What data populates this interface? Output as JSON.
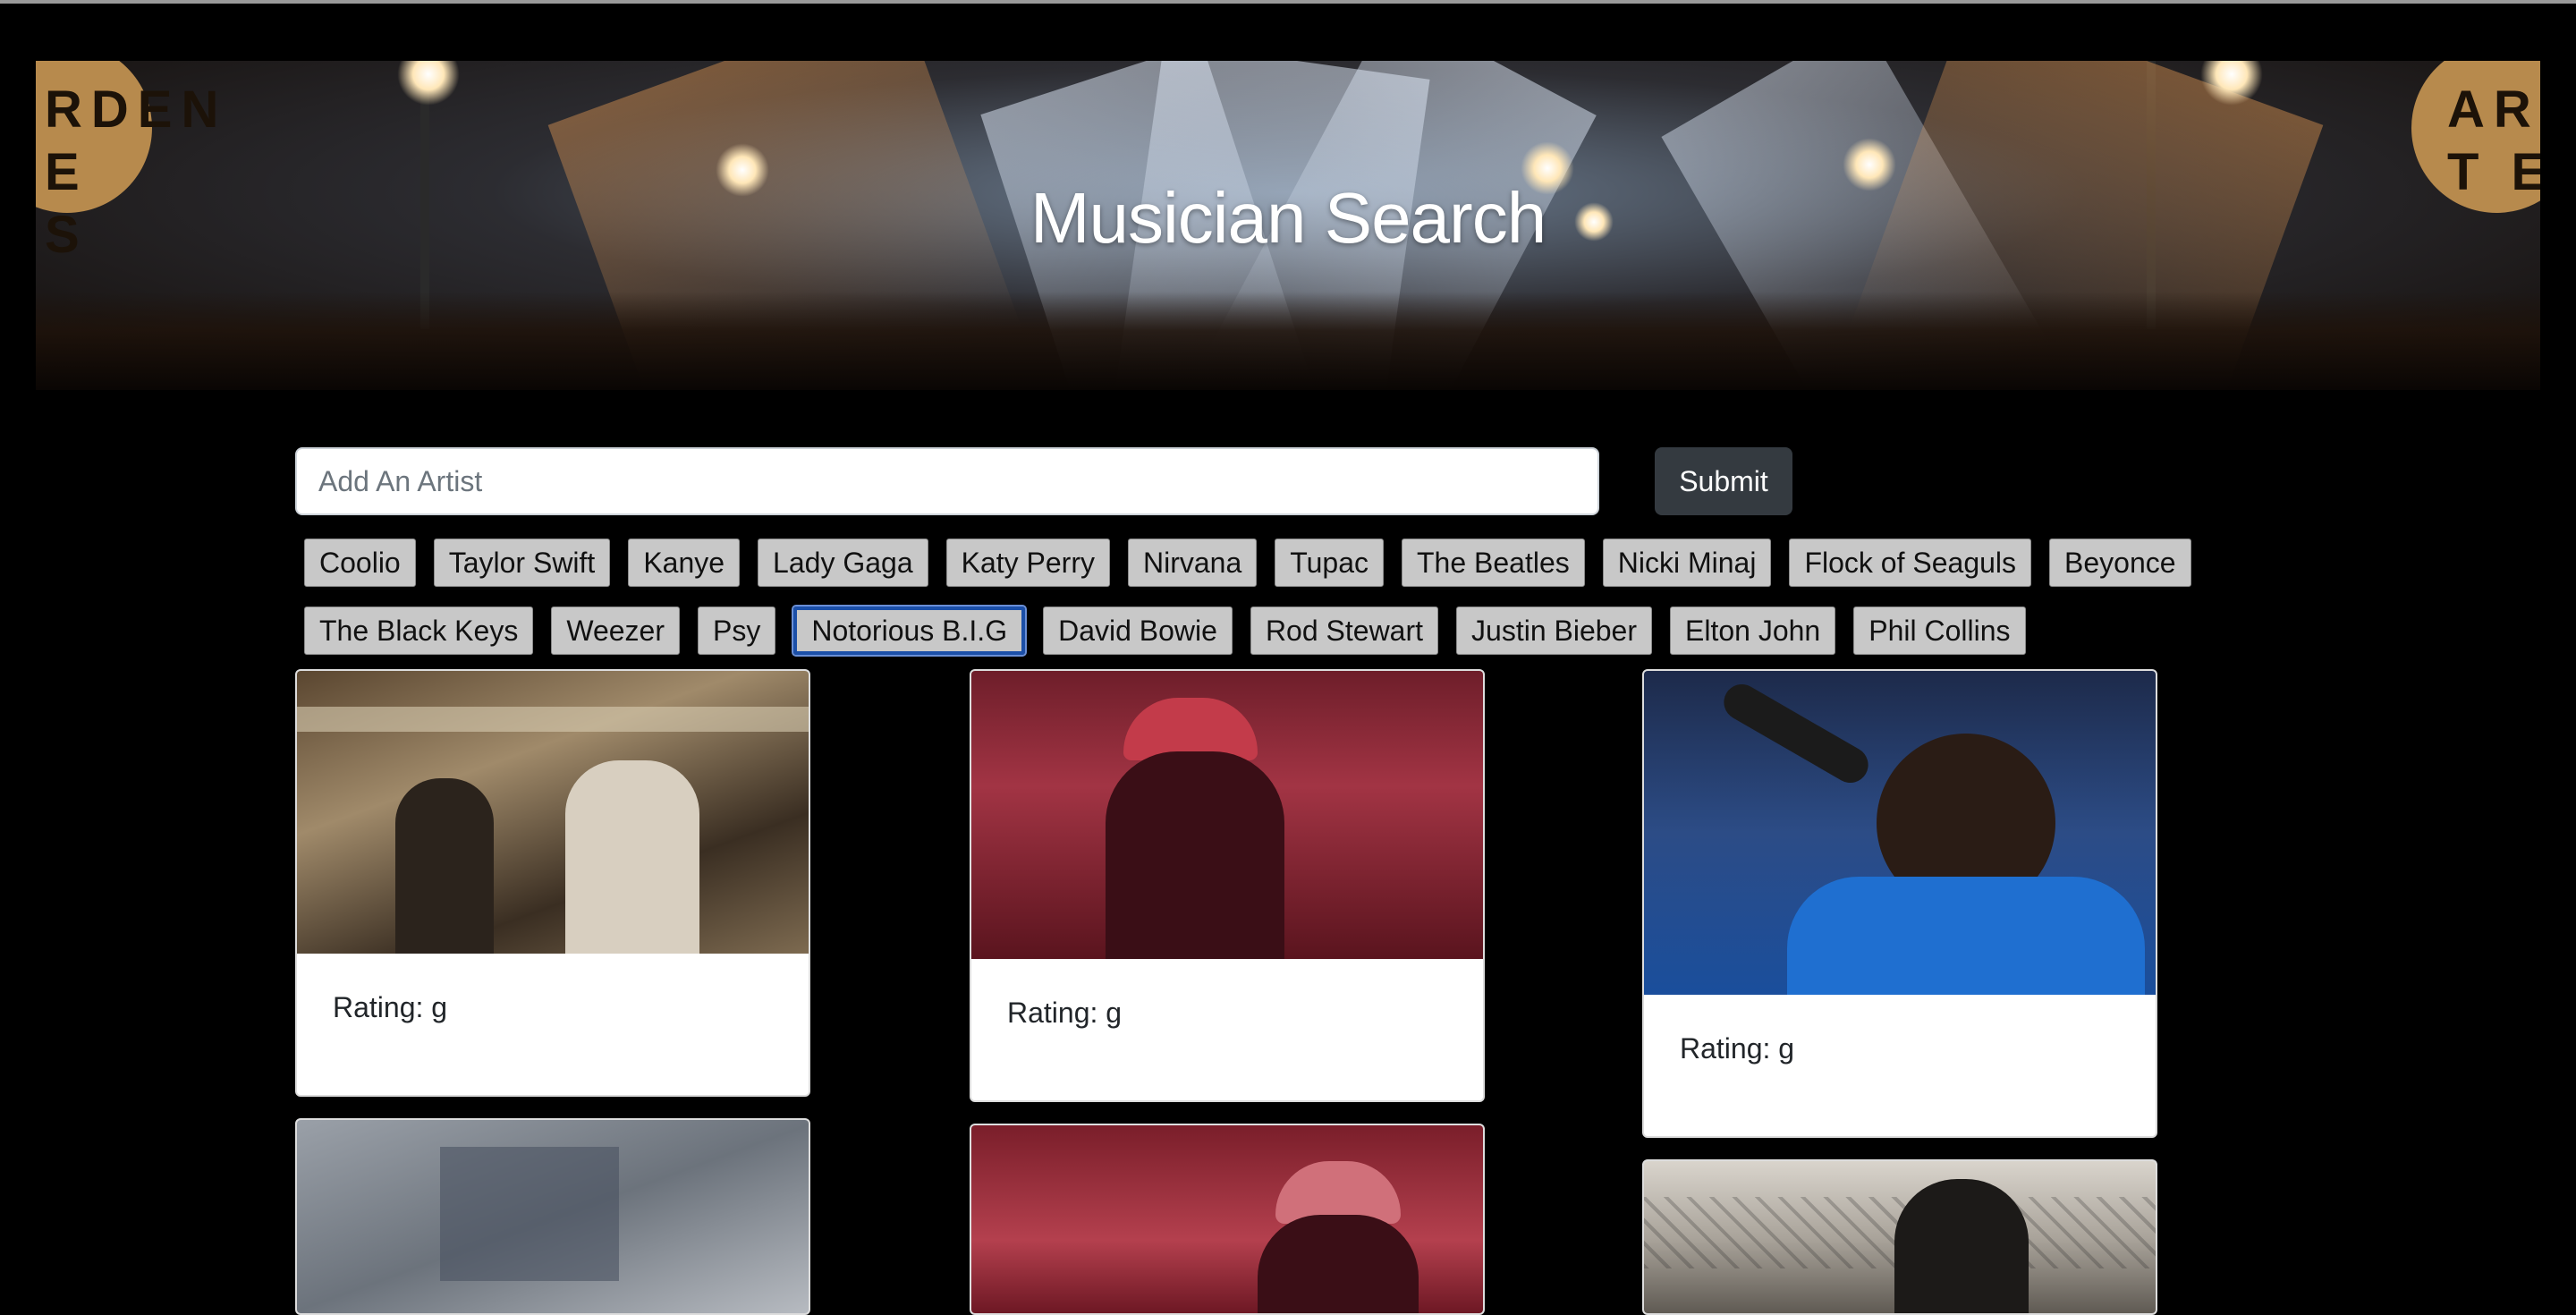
{
  "hero": {
    "title": "Musician Search",
    "sign_left": "RDEN\nE S",
    "sign_right": "ARD\nT E"
  },
  "form": {
    "placeholder": "Add An Artist",
    "submit_label": "Submit"
  },
  "artists": {
    "row1": [
      "Coolio",
      "Taylor Swift",
      "Kanye",
      "Lady Gaga",
      "Katy Perry",
      "Nirvana",
      "Tupac",
      "The Beatles",
      "Nicki Minaj",
      "Flock of Seaguls",
      "Beyonce"
    ],
    "row2": [
      "The Black Keys",
      "Weezer",
      "Psy",
      "Notorious B.I.G",
      "David Bowie",
      "Rod Stewart",
      "Justin Bieber",
      "Elton John",
      "Phil Collins"
    ],
    "selected": "Notorious B.I.G"
  },
  "results": [
    {
      "rating": "Rating: g",
      "tint": "#6b5a45"
    },
    {
      "rating": "Rating: g",
      "tint": "#8c2a35"
    },
    {
      "rating": "Rating: g",
      "tint": "#2a5aa0"
    },
    {
      "rating": "",
      "tint": "#8a8f96"
    },
    {
      "rating": "",
      "tint": "#9a3a44"
    },
    {
      "rating": "",
      "tint": "#7a766f"
    }
  ]
}
